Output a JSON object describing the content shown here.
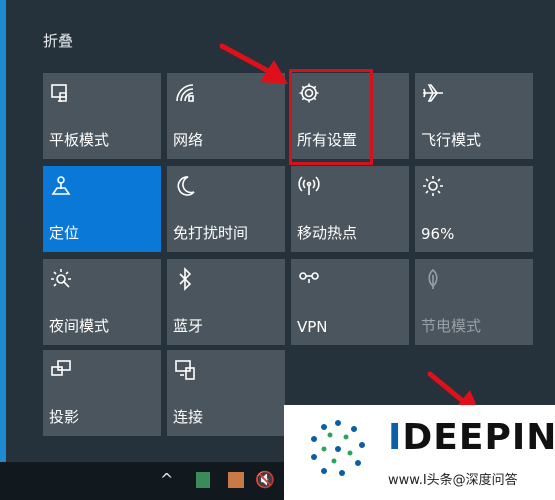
{
  "header": {
    "collapse_label": "折叠"
  },
  "tiles": [
    {
      "label": "平板模式",
      "icon": "tablet-mode-icon",
      "state": "off"
    },
    {
      "label": "网络",
      "icon": "network-icon",
      "state": "off"
    },
    {
      "label": "所有设置",
      "icon": "gear-icon",
      "state": "off"
    },
    {
      "label": "飞行模式",
      "icon": "airplane-icon",
      "state": "off"
    },
    {
      "label": "定位",
      "icon": "location-icon",
      "state": "on"
    },
    {
      "label": "免打扰时间",
      "icon": "moon-icon",
      "state": "off"
    },
    {
      "label": "移动热点",
      "icon": "hotspot-icon",
      "state": "off"
    },
    {
      "label": "96%",
      "icon": "brightness-icon",
      "state": "off"
    },
    {
      "label": "夜间模式",
      "icon": "night-light-icon",
      "state": "off"
    },
    {
      "label": "蓝牙",
      "icon": "bluetooth-icon",
      "state": "off"
    },
    {
      "label": "VPN",
      "icon": "vpn-icon",
      "state": "off"
    },
    {
      "label": "节电模式",
      "icon": "battery-saver-icon",
      "state": "disabled"
    },
    {
      "label": "投影",
      "icon": "project-icon",
      "state": "off"
    },
    {
      "label": "连接",
      "icon": "connect-icon",
      "state": "off"
    }
  ],
  "colors": {
    "active_tile": "#0a78d7",
    "tile": "#4b555d",
    "highlight": "#d4121b"
  },
  "taskbar": {
    "chevron": "^",
    "mute": "🔇"
  },
  "watermark": {
    "title_left": "I",
    "title_rest": "DEEPIN",
    "url": "www.I头条@深度问答"
  }
}
